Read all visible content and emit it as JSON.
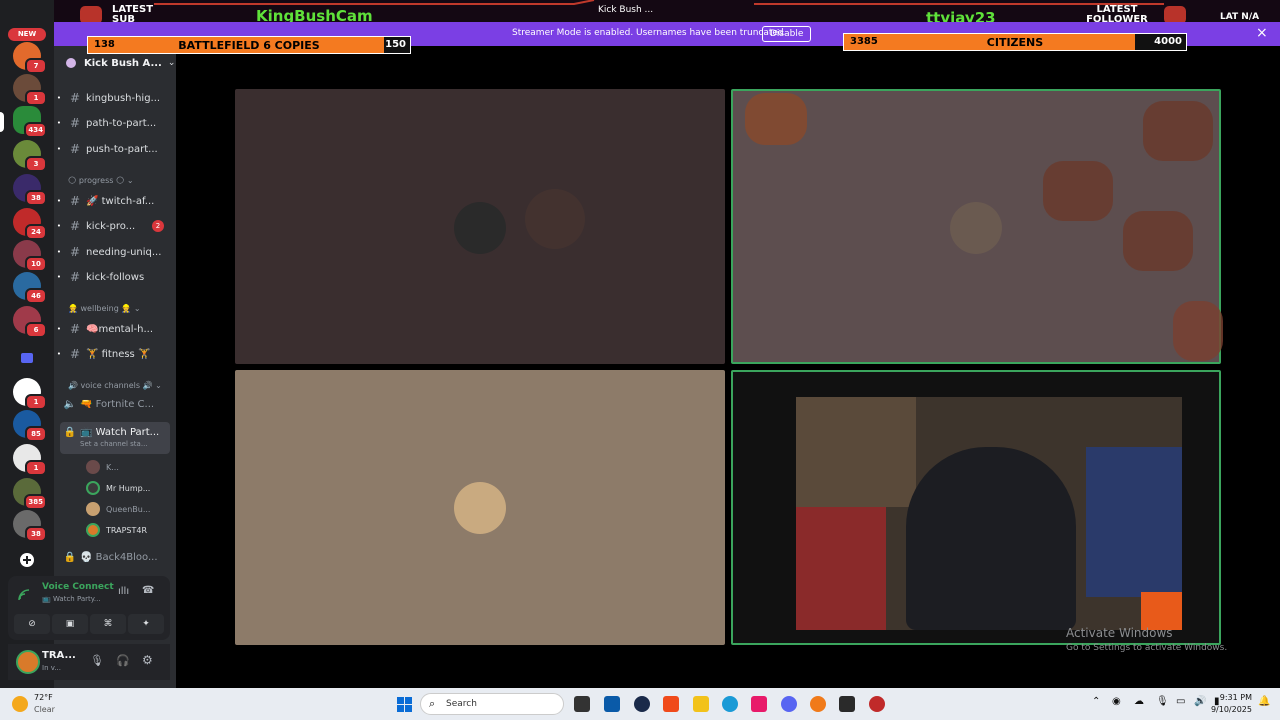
{
  "overlay": {
    "latest_sub_label": "LATEST SUB",
    "streamer_name": "KingBushCam",
    "latest_sub_name": "ttvjay23",
    "latest_follower_label": "LATEST FOLLOWER",
    "latest_follower_value": "N/A",
    "latest_follower_prefix": "LAT",
    "goal1": {
      "current": "138",
      "label": "BATTLEFIELD 6 COPIES",
      "target": "150",
      "progress": 0.92
    },
    "goal2": {
      "current": "3385",
      "label": "CITIZENS",
      "target": "4000",
      "progress": 0.85
    },
    "window_title": "Kick Bush ..."
  },
  "streamer_mode": {
    "message": "Streamer Mode is enabled. Usernames have been truncated.",
    "button": "Disable",
    "close": "×"
  },
  "rail": {
    "new_label": "NEW",
    "badges": [
      "7",
      "1",
      "434",
      "3",
      "38",
      "24",
      "10",
      "46",
      "6",
      "1",
      "85",
      "1",
      "385",
      "38"
    ]
  },
  "sidebar": {
    "guild_name": "Kick Bush A...",
    "channels_top": [
      {
        "name": "kingbush-hig..."
      },
      {
        "name": "path-to-part..."
      },
      {
        "name": "push-to-part..."
      }
    ],
    "category_progress": "🌕 progress 🌕",
    "channels_progress": [
      {
        "name": "🚀 twitch-af..."
      },
      {
        "name": "kick-pro...",
        "unread": "2"
      },
      {
        "name": "needing-uniq..."
      },
      {
        "name": "kick-follows"
      }
    ],
    "category_wellbeing": "👷 wellbeing 👷",
    "channels_wellbeing": [
      {
        "name": "🧠mental-h..."
      },
      {
        "name": "🏋 fitness 🏋"
      }
    ],
    "category_voice": "🔊 voice channels 🔊",
    "voice_fortnite": "🔫 Fortnite C...",
    "voice_watch": "📺 Watch Part...",
    "voice_watch_status": "Set a channel sta...",
    "voice_users": [
      "K...",
      "Mr Hump...",
      "QueenBu...",
      "TRAPST4R"
    ],
    "voice_back4blood": "💀 Back4Bloo..."
  },
  "voice_panel": {
    "status": "Voice Connect",
    "channel": "📺 Watch Party..."
  },
  "user_panel": {
    "name": "TRA...",
    "status": "In v..."
  },
  "activate_windows": {
    "title": "Activate Windows",
    "subtitle": "Go to Settings to activate Windows."
  },
  "taskbar": {
    "weather_temp": "72°F",
    "weather_desc": "Clear",
    "search_placeholder": "Search",
    "time": "9:31 PM",
    "date": "9/10/2025"
  },
  "colors": {
    "discord_rail": "#1e1f22",
    "discord_sidebar": "#2b2d31",
    "overlay_purple": "#7b3fe4",
    "goal_orange": "#f47a20",
    "speaking_green": "#3ba55d"
  }
}
